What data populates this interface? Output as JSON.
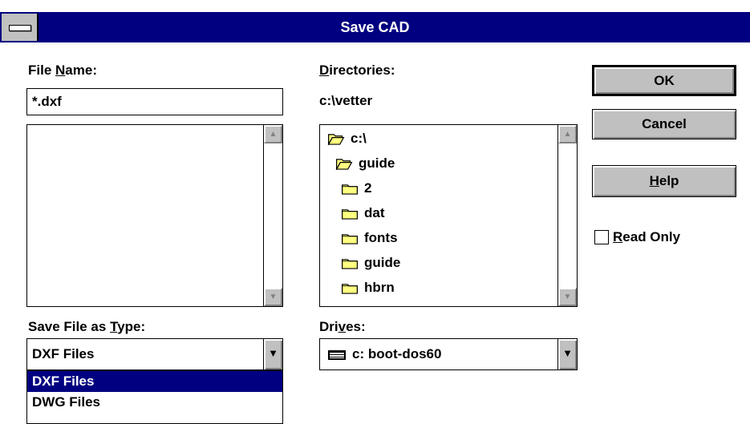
{
  "window": {
    "title": "Save CAD"
  },
  "file_name": {
    "label_pre": "File ",
    "label_key": "N",
    "label_post": "ame:",
    "value": "*.dxf",
    "files": []
  },
  "directories": {
    "label_key": "D",
    "label_post": "irectories:",
    "current_path": "c:\\vetter",
    "items": [
      {
        "name": "c:\\",
        "icon": "open-folder-icon"
      },
      {
        "name": "guide",
        "icon": "open-folder-icon"
      },
      {
        "name": "2",
        "icon": "folder-icon"
      },
      {
        "name": "dat",
        "icon": "folder-icon"
      },
      {
        "name": "fonts",
        "icon": "folder-icon"
      },
      {
        "name": "guide",
        "icon": "folder-icon"
      },
      {
        "name": "hbrn",
        "icon": "folder-icon"
      }
    ]
  },
  "buttons": {
    "ok": "OK",
    "cancel": "Cancel",
    "help_key": "H",
    "help_post": "elp"
  },
  "read_only": {
    "key": "R",
    "post": "ead Only",
    "checked": false
  },
  "save_type": {
    "label_pre": "Save File as ",
    "label_key": "T",
    "label_post": "ype:",
    "selected": "DXF Files",
    "options": [
      "DXF Files",
      "DWG Files"
    ],
    "highlighted_option": "DXF Files"
  },
  "drives": {
    "label_pre": "Dri",
    "label_key": "v",
    "label_post": "es:",
    "selected": "c: boot-dos60",
    "icon": "drive-icon"
  },
  "colors": {
    "title_bar": "#000080",
    "face": "#c0c0c0",
    "folder": "#ffff80",
    "selection": "#000080"
  }
}
